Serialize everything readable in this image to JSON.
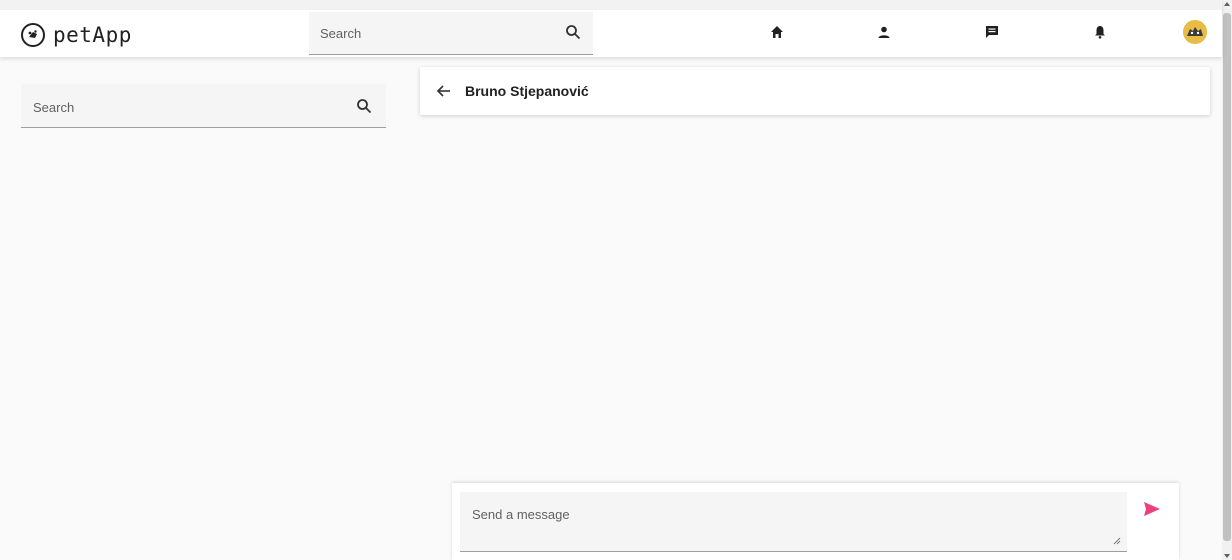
{
  "app": {
    "name": "petApp",
    "logo_icon": "paw-circle-icon"
  },
  "header": {
    "search_placeholder": "Search",
    "nav": [
      {
        "name": "home",
        "icon": "home-icon"
      },
      {
        "name": "profile",
        "icon": "person-icon"
      },
      {
        "name": "messages",
        "icon": "chat-icon"
      },
      {
        "name": "notifications",
        "icon": "bell-icon"
      }
    ],
    "avatar_icon": "user-avatar"
  },
  "sidebar": {
    "search_placeholder": "Search"
  },
  "chat": {
    "contact_name": "Bruno Stjepanović",
    "composer_placeholder": "Send a message",
    "send_color": "#ec407a"
  },
  "colors": {
    "accent": "#ec407a",
    "field_bg": "#f5f5f5",
    "text": "#212121"
  }
}
